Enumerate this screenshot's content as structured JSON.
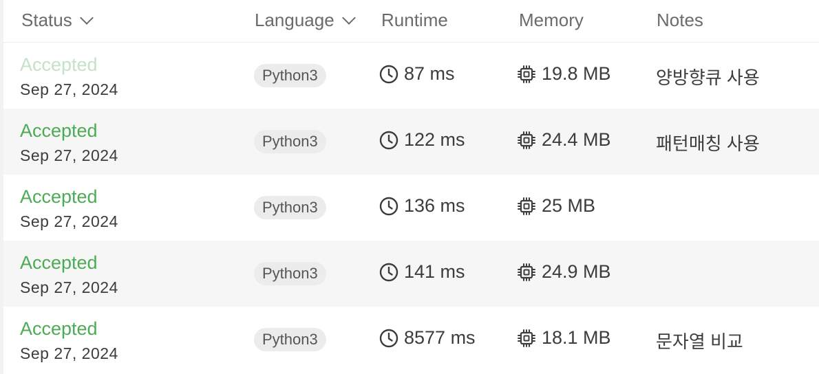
{
  "header": {
    "status": "Status",
    "language": "Language",
    "runtime": "Runtime",
    "memory": "Memory",
    "notes": "Notes"
  },
  "icons": {
    "clock": "clock-icon",
    "chip": "chip-icon",
    "dropdown": "chevron-down-icon"
  },
  "colors": {
    "accepted": "#4daa57",
    "accepted_faded": "#c5e2c8",
    "pill_bg": "#ececec",
    "alt_row_bg": "#f6f6f6"
  },
  "submissions": [
    {
      "status": "Accepted",
      "date": "Sep 27, 2024",
      "language": "Python3",
      "runtime": "87 ms",
      "memory": "19.8 MB",
      "notes": "양방향큐 사용"
    },
    {
      "status": "Accepted",
      "date": "Sep 27, 2024",
      "language": "Python3",
      "runtime": "122 ms",
      "memory": "24.4 MB",
      "notes": "패턴매칭 사용"
    },
    {
      "status": "Accepted",
      "date": "Sep 27, 2024",
      "language": "Python3",
      "runtime": "136 ms",
      "memory": "25 MB",
      "notes": ""
    },
    {
      "status": "Accepted",
      "date": "Sep 27, 2024",
      "language": "Python3",
      "runtime": "141 ms",
      "memory": "24.9 MB",
      "notes": ""
    },
    {
      "status": "Accepted",
      "date": "Sep 27, 2024",
      "language": "Python3",
      "runtime": "8577 ms",
      "memory": "18.1 MB",
      "notes": "문자열 비교"
    }
  ]
}
